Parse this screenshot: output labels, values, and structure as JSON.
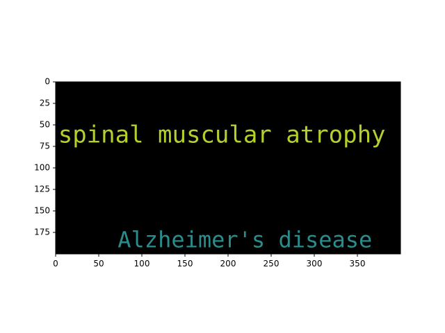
{
  "chart_data": {
    "type": "wordcloud",
    "background": "#000000",
    "xlim": [
      0,
      400
    ],
    "ylim": [
      200,
      0
    ],
    "x_ticks": [
      0,
      50,
      100,
      150,
      200,
      250,
      300,
      350
    ],
    "y_ticks": [
      0,
      25,
      50,
      75,
      100,
      125,
      150,
      175
    ],
    "words": [
      {
        "text": "spinal muscular atrophy",
        "x": 3,
        "y": 63,
        "color": "#b5cf2c"
      },
      {
        "text": "Alzheimer's disease",
        "x": 72,
        "y": 185,
        "color": "#2a8c8c"
      }
    ]
  }
}
